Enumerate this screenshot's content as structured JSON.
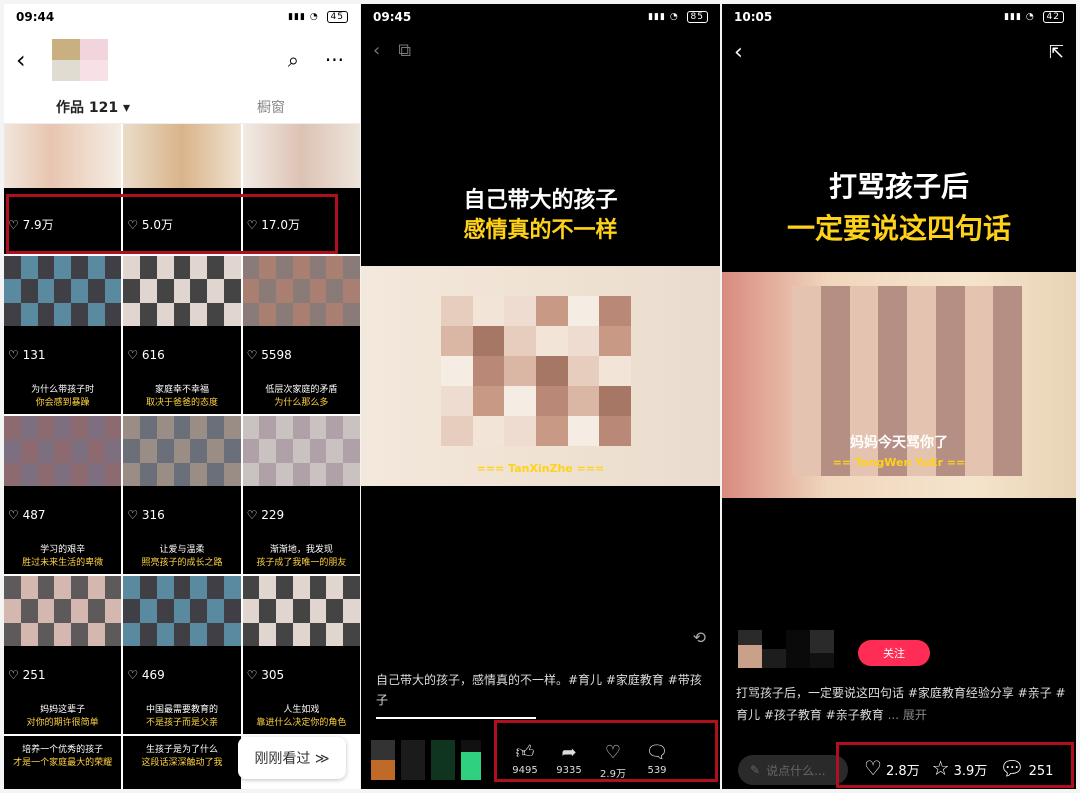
{
  "panel1": {
    "status": {
      "time": "09:44",
      "battery": "45"
    },
    "tabs": [
      {
        "label": "作品 121 ▾"
      },
      {
        "label": "橱窗"
      }
    ],
    "cells": [
      {
        "likes": "7.9万",
        "cap1": "",
        "cap2": ""
      },
      {
        "likes": "5.0万",
        "cap1": "",
        "cap2": ""
      },
      {
        "likes": "17.0万",
        "cap1": "",
        "cap2": ""
      },
      {
        "likes": "131",
        "cap1": "为什么带孩子时",
        "cap2": "你会感到暴躁"
      },
      {
        "likes": "616",
        "cap1": "家庭幸不幸福",
        "cap2": "取决于爸爸的态度"
      },
      {
        "likes": "5598",
        "cap1": "低层次家庭的矛盾",
        "cap2": "为什么那么多"
      },
      {
        "likes": "487",
        "cap1": "学习的艰辛",
        "cap2": "胜过未来生活的卑微"
      },
      {
        "likes": "316",
        "cap1": "让爱与温柔",
        "cap2": "照亮孩子的成长之路"
      },
      {
        "likes": "229",
        "cap1": "渐渐地，我发现",
        "cap2": "孩子成了我唯一的朋友"
      },
      {
        "likes": "251",
        "cap1": "妈妈这辈子",
        "cap2": "对你的期许很简单"
      },
      {
        "likes": "469",
        "cap1": "中国最需要教育的",
        "cap2": "不是孩子而是父亲"
      },
      {
        "likes": "305",
        "cap1": "人生如戏",
        "cap2": "靠进什么决定你的角色"
      }
    ],
    "bottom_caps": [
      {
        "cap1": "培养一个优秀的孩子",
        "cap2": "才是一个家庭最大的荣耀"
      },
      {
        "cap1": "生孩子是为了什么",
        "cap2": "这段话深深触动了我"
      }
    ],
    "seen_button": "刚刚看过 ≫"
  },
  "panel2": {
    "status": {
      "time": "09:45",
      "battery": "85"
    },
    "headline1": "自己带大的孩子",
    "headline2": "感情真的不一样",
    "watermark": "=== TanXinZhe ===",
    "desc": "自己带大的孩子，感情真的不一样。#育儿 #家庭教育 #带孩子",
    "actions": [
      {
        "icon": "thumbs-up-icon",
        "count": "9495"
      },
      {
        "icon": "share-icon",
        "count": "9335"
      },
      {
        "icon": "heart-icon",
        "count": "2.9万"
      },
      {
        "icon": "comment-icon",
        "count": "539"
      }
    ]
  },
  "panel3": {
    "status": {
      "time": "10:05",
      "battery": "42"
    },
    "headline1": "打骂孩子后",
    "headline2": "一定要说这四句话",
    "subtitle": "妈妈今天骂你了",
    "watermark": "== TongWen YuEr ==",
    "follow": "关注",
    "desc": "打骂孩子后，一定要说这四句话 #家庭教育经验分享 #亲子 #育儿 #孩子教育 #亲子教育",
    "more": "... 展开",
    "comment_placeholder": "说点什么...",
    "like_count": "2.8万",
    "star_count": "3.9万",
    "comment_count": "251"
  },
  "colors": {
    "highlight_box": "#b0101e",
    "yellow_text": "#ffd21a",
    "follow": "#ff2d55"
  }
}
